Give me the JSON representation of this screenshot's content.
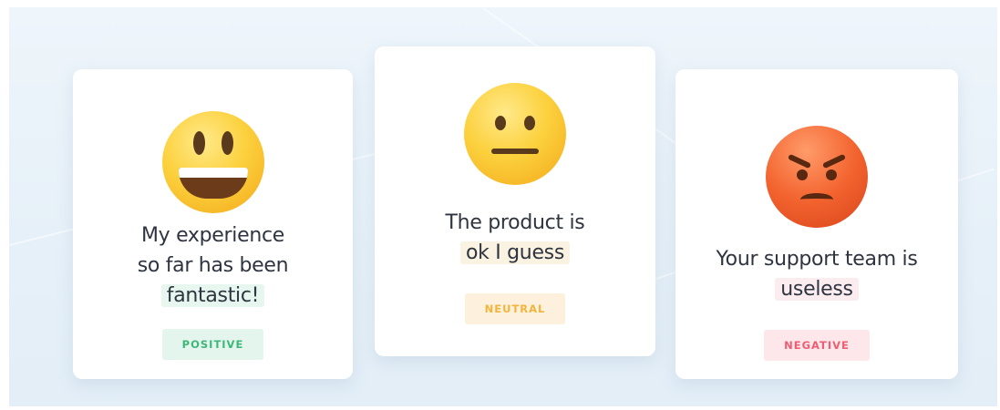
{
  "cards": [
    {
      "emoji": "grinning-face-icon",
      "quote_lines": [
        "My experience",
        "so far has been"
      ],
      "highlight": "fantastic!",
      "label": "POSITIVE",
      "color": "#3fb77a"
    },
    {
      "emoji": "neutral-face-icon",
      "quote_lines": [
        "The product is"
      ],
      "highlight": "ok I guess",
      "label": "NEUTRAL",
      "color": "#f2b53c"
    },
    {
      "emoji": "angry-face-icon",
      "quote_lines": [
        "Your support team is"
      ],
      "highlight": "useless",
      "label": "NEGATIVE",
      "color": "#ee5d72"
    }
  ]
}
